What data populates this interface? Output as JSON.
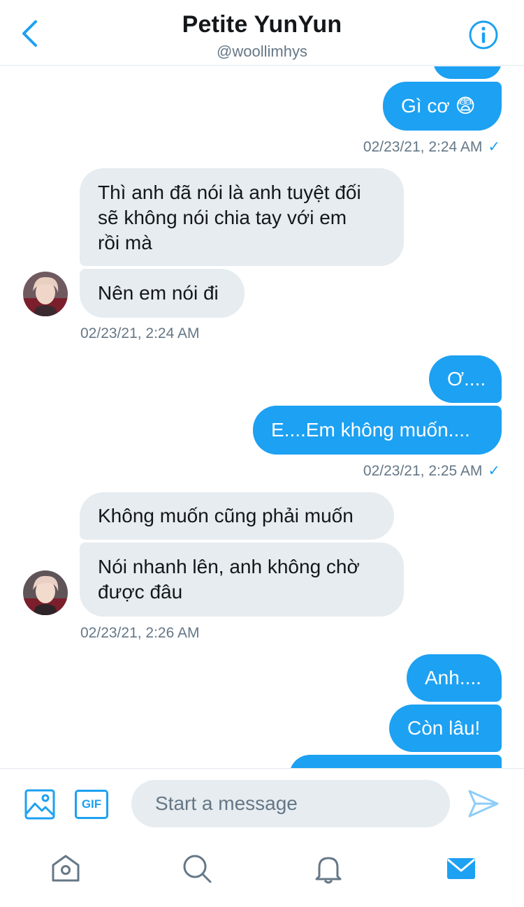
{
  "header": {
    "title": "Petite YunYun",
    "handle": "@woollimhys"
  },
  "messages": {
    "m1": "Gì cơ 😨",
    "t1": "02/23/21, 2:24 AM",
    "m2": "Thì anh đã nói là anh tuyệt đối\nsẽ không nói chia tay với em\nrồi mà",
    "m3": "Nên em nói đi",
    "t2": "02/23/21, 2:24 AM",
    "m4": "Ơ....",
    "m5": "E....Em không muốn....",
    "t3": "02/23/21, 2:25 AM",
    "m6": "Không muốn cũng phải muốn",
    "m7": "Nói nhanh lên, anh không chờ\nđược đâu",
    "t4": "02/23/21, 2:26 AM",
    "m8": "Anh....",
    "m9": "Còn lâu!",
    "check": "✓"
  },
  "composer": {
    "gif_label": "GIF",
    "placeholder": "Start a message"
  },
  "colors": {
    "accent": "#1da1f2",
    "incoming_bubble": "#e6ecf0"
  },
  "icons": {
    "back": "chevron-left-icon",
    "info": "info-icon",
    "media": "image-icon",
    "send": "send-icon",
    "home": "home-icon",
    "search": "search-icon",
    "notifications": "bell-icon",
    "messages": "mail-icon"
  }
}
